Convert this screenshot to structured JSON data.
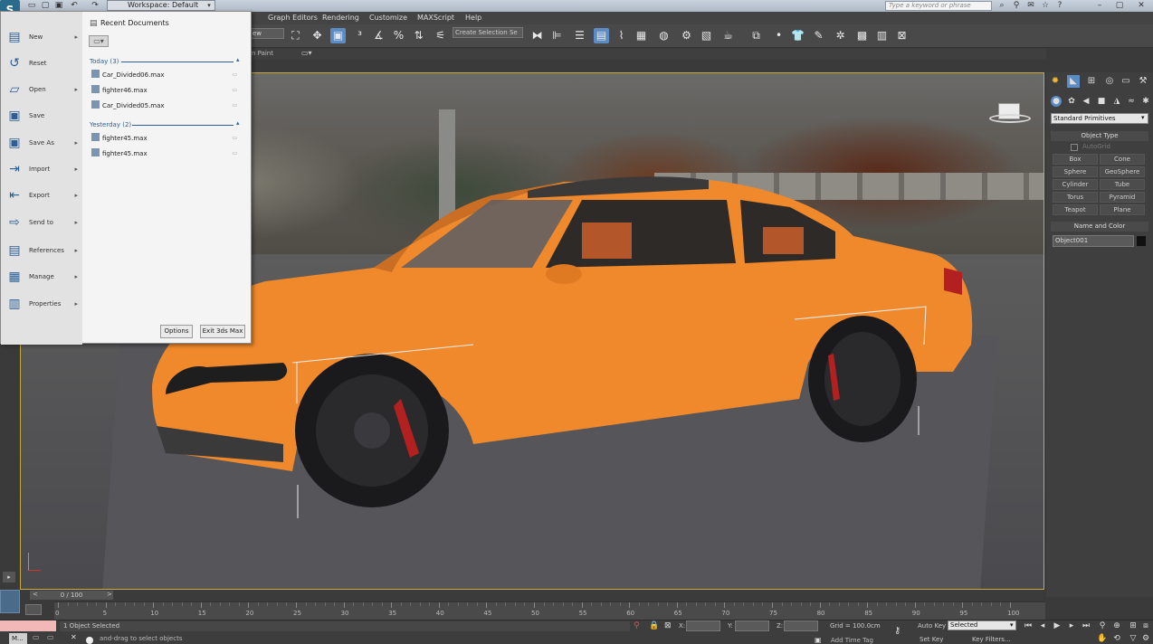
{
  "titlebar": {
    "workspace": "Workspace: Default",
    "search_placeholder": "Type a keyword or phrase"
  },
  "menubar": [
    "Graph Editors",
    "Rendering",
    "Customize",
    "MAXScript",
    "Help"
  ],
  "toolbar": {
    "view_dropdown": "ew",
    "selection_set": "Create Selection Se",
    "ribbon_label": "n Paint"
  },
  "app_menu": {
    "items": [
      {
        "label": "New",
        "icon": "new-icon",
        "arrow": true
      },
      {
        "label": "Reset",
        "icon": "reset-icon",
        "arrow": false
      },
      {
        "label": "Open",
        "icon": "open-icon",
        "arrow": true
      },
      {
        "label": "Save",
        "icon": "save-icon",
        "arrow": false
      },
      {
        "label": "Save As",
        "icon": "save-as-icon",
        "arrow": true
      },
      {
        "label": "Import",
        "icon": "import-icon",
        "arrow": true
      },
      {
        "label": "Export",
        "icon": "export-icon",
        "arrow": true
      },
      {
        "label": "Send to",
        "icon": "send-to-icon",
        "arrow": true
      },
      {
        "label": "References",
        "icon": "references-icon",
        "arrow": true
      },
      {
        "label": "Manage",
        "icon": "manage-icon",
        "arrow": true
      },
      {
        "label": "Properties",
        "icon": "properties-icon",
        "arrow": true
      }
    ],
    "recent_title": "Recent Documents",
    "groups": [
      {
        "label": "Today (3)",
        "docs": [
          "Car_Divided06.max",
          "fighter46.max",
          "Car_Divided05.max"
        ]
      },
      {
        "label": "Yesterday (2)",
        "docs": [
          "fighter45.max",
          "fighter45.max"
        ]
      }
    ],
    "options_label": "Options",
    "exit_label": "Exit 3ds Max"
  },
  "command_panel": {
    "category": "Standard Primitives",
    "object_type_title": "Object Type",
    "autogrid": "AutoGrid",
    "primitives": [
      "Box",
      "Cone",
      "Sphere",
      "GeoSphere",
      "Cylinder",
      "Tube",
      "Torus",
      "Pyramid",
      "Teapot",
      "Plane"
    ],
    "name_color_title": "Name and Color",
    "object_name": "Object001",
    "object_color": "#111111"
  },
  "timeline": {
    "position": "0 / 100",
    "ticks": [
      "0",
      "5",
      "10",
      "15",
      "20",
      "25",
      "30",
      "35",
      "40",
      "45",
      "50",
      "55",
      "60",
      "65",
      "70",
      "75",
      "80",
      "85",
      "90",
      "95",
      "100"
    ]
  },
  "status": {
    "selection": "1 Object Selected",
    "prompt": "and-drag to select objects",
    "x_label": "X:",
    "y_label": "Y:",
    "z_label": "Z:",
    "grid": "Grid = 100.0cm",
    "add_time_tag": "Add Time Tag",
    "auto_key": "Auto Key",
    "set_key": "Set Key",
    "key_mode": "Selected",
    "key_filters": "Key Filters...",
    "maxscript_mini": "M..."
  },
  "colors": {
    "car": "#f0892c",
    "accent": "#5b8cc4",
    "viewport_border": "#c9a93a"
  }
}
